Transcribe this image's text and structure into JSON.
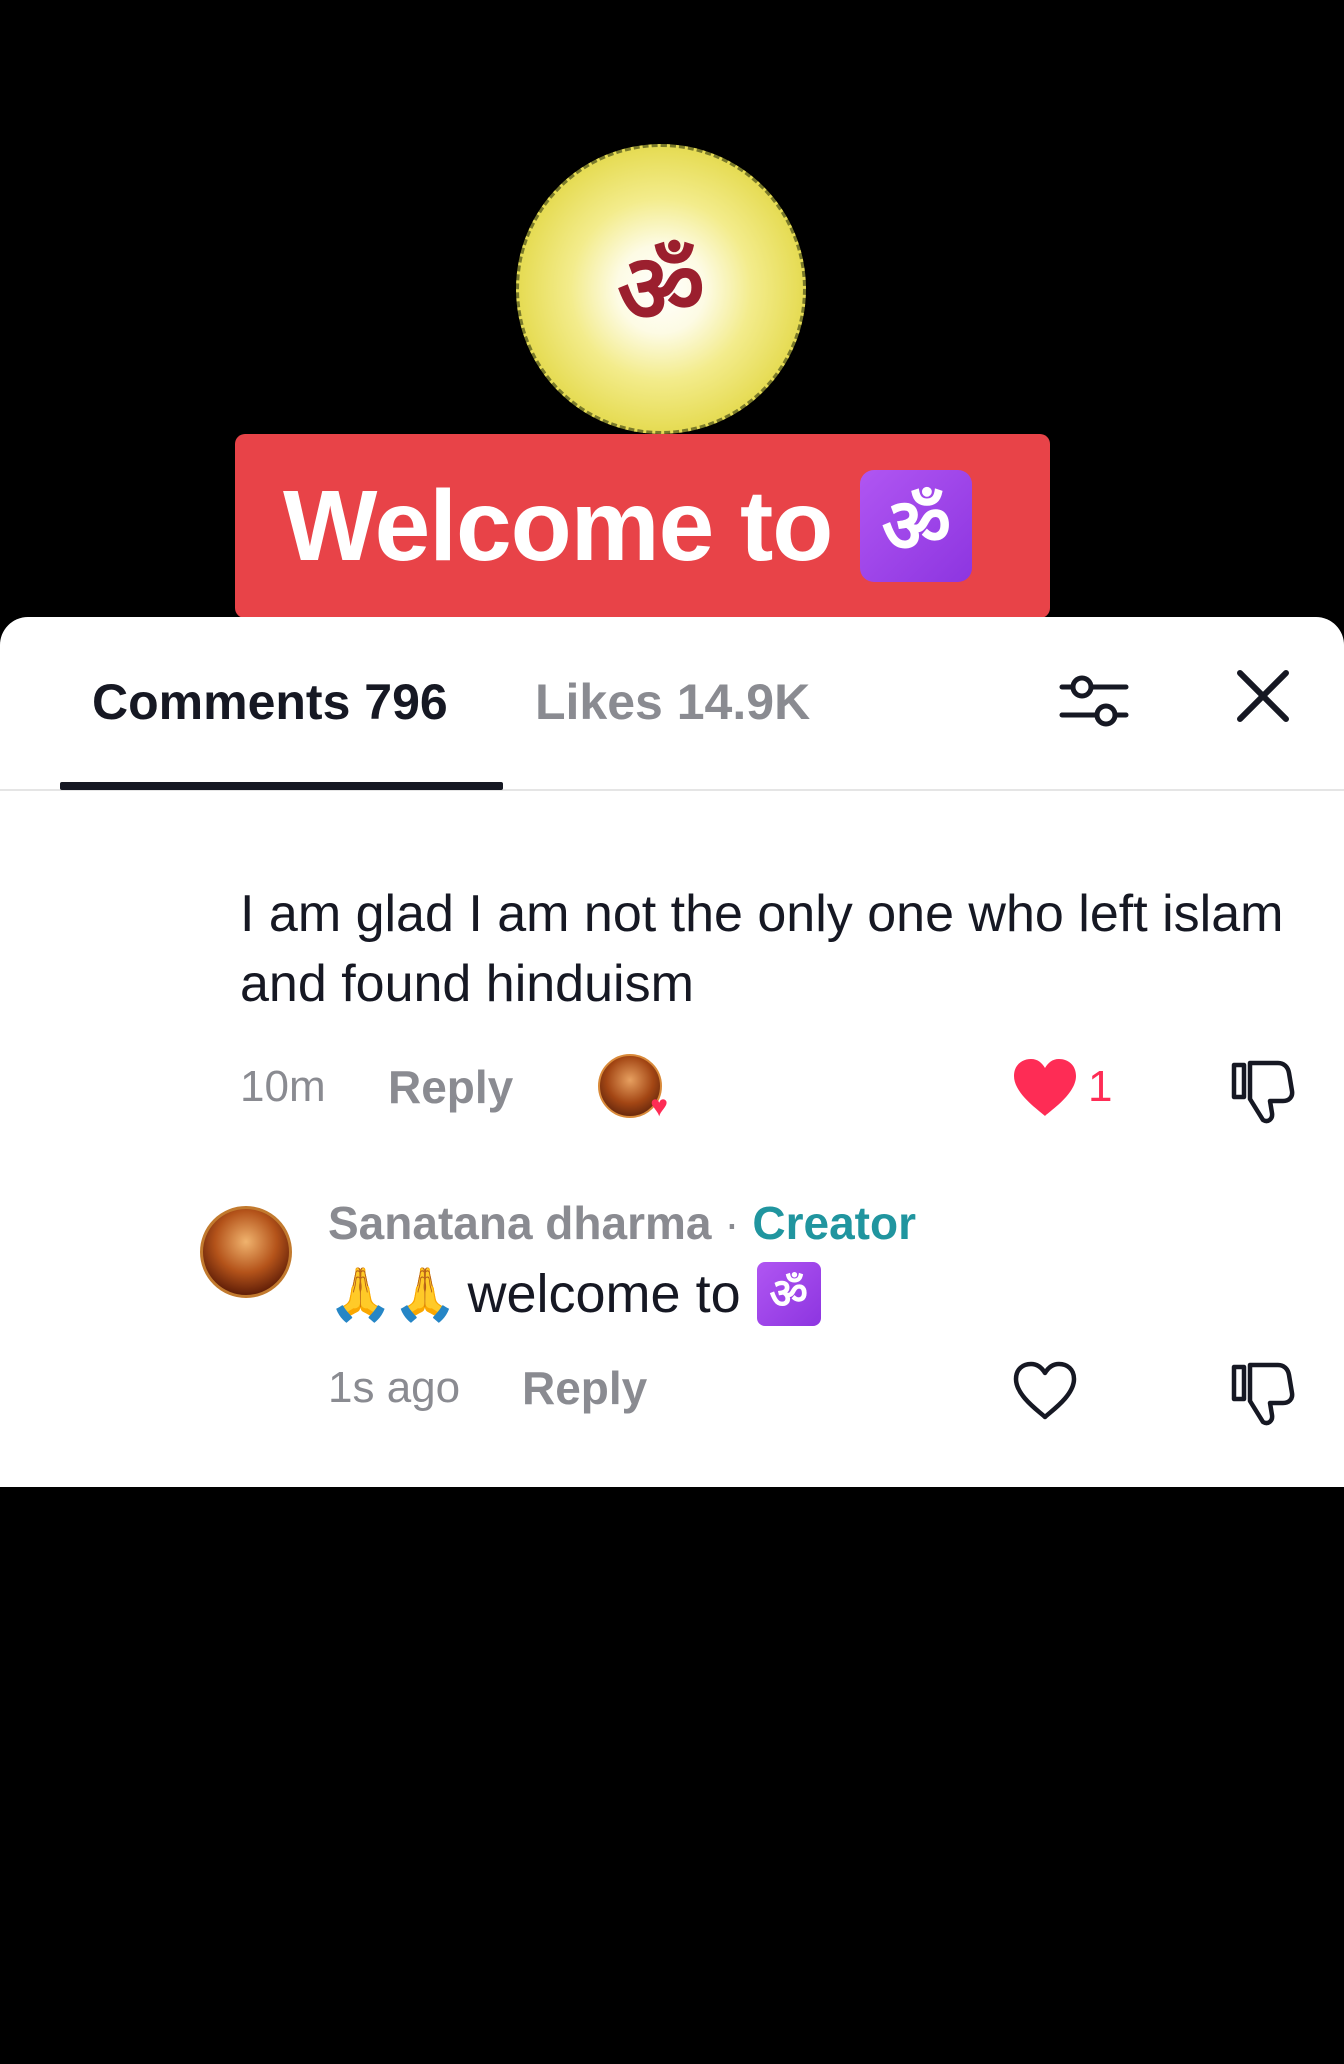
{
  "overlay": {
    "emblem_glyph": "ॐ",
    "banner_text": "Welcome to",
    "banner_glyph": "ॐ"
  },
  "tabs": [
    {
      "label": "Comments 796"
    },
    {
      "label": "Likes 14.9K"
    }
  ],
  "comment": {
    "text": "I am glad I am not the only one who left islam and found hinduism",
    "time": "10m",
    "reply_label": "Reply",
    "like_count": "1"
  },
  "reply": {
    "author": "Sanatana dharma",
    "separator": "·",
    "badge": "Creator",
    "emoji": "🙏🙏",
    "text": "welcome to",
    "glyph": "ॐ",
    "time": "1s ago",
    "reply_label": "Reply"
  },
  "colors": {
    "accent_red": "#fe2c55",
    "creator_teal": "#20959f",
    "banner_red": "#e84348"
  },
  "icons": [
    "filter-icon",
    "close-icon",
    "heart-icon",
    "dislike-icon",
    "heart-outline-icon"
  ]
}
